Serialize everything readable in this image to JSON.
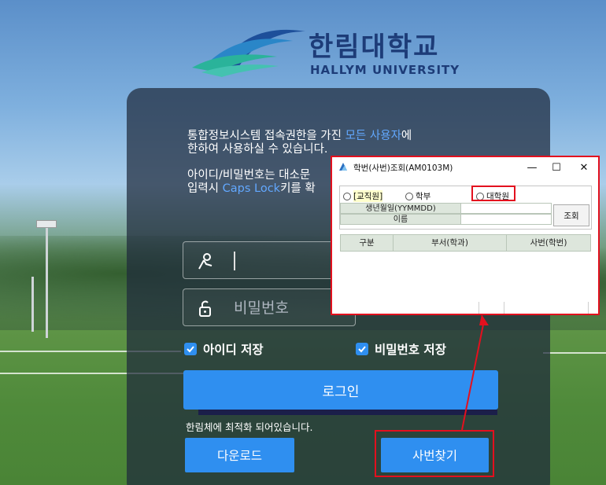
{
  "logo": {
    "title": "한림대학교",
    "subtitle": "HALLYM UNIVERSITY"
  },
  "notice": {
    "line1_pre": "통합정보시스템 접속권한을 가진 ",
    "line1_hl": "모든 사용자",
    "line1_post": "에",
    "line2": "한하여 사용하실 수 있습니다.",
    "line3": "아이디/비밀번호는 대소문",
    "line4_pre": "입력시 ",
    "line4_hl": "Caps Lock",
    "line4_post": "키를 확"
  },
  "form": {
    "password_placeholder": "비밀번호",
    "save_id_label": "아이디 저장",
    "save_pw_label": "비밀번호 저장",
    "save_id_checked": true,
    "save_pw_checked": true,
    "login_label": "로그인",
    "optimized_note": "한림체에 최적화 되어있습니다.",
    "download_label": "다운로드",
    "find_id_label": "사번찾기"
  },
  "dialog": {
    "title": "학번(사번)조회(AM0103M)",
    "radios": [
      {
        "label": "[교직원]",
        "selected": false
      },
      {
        "label": "학부",
        "selected": false
      },
      {
        "label": "대학원",
        "selected": false
      }
    ],
    "birth_label": "생년월일(YYMMDD)",
    "name_label": "이름",
    "query_label": "조회",
    "columns": [
      "구분",
      "부서(학과)",
      "사번(학번)"
    ]
  },
  "colors": {
    "accent": "#2f8ff0",
    "highlight": "#e3101e",
    "brand": "#1d3c78"
  }
}
